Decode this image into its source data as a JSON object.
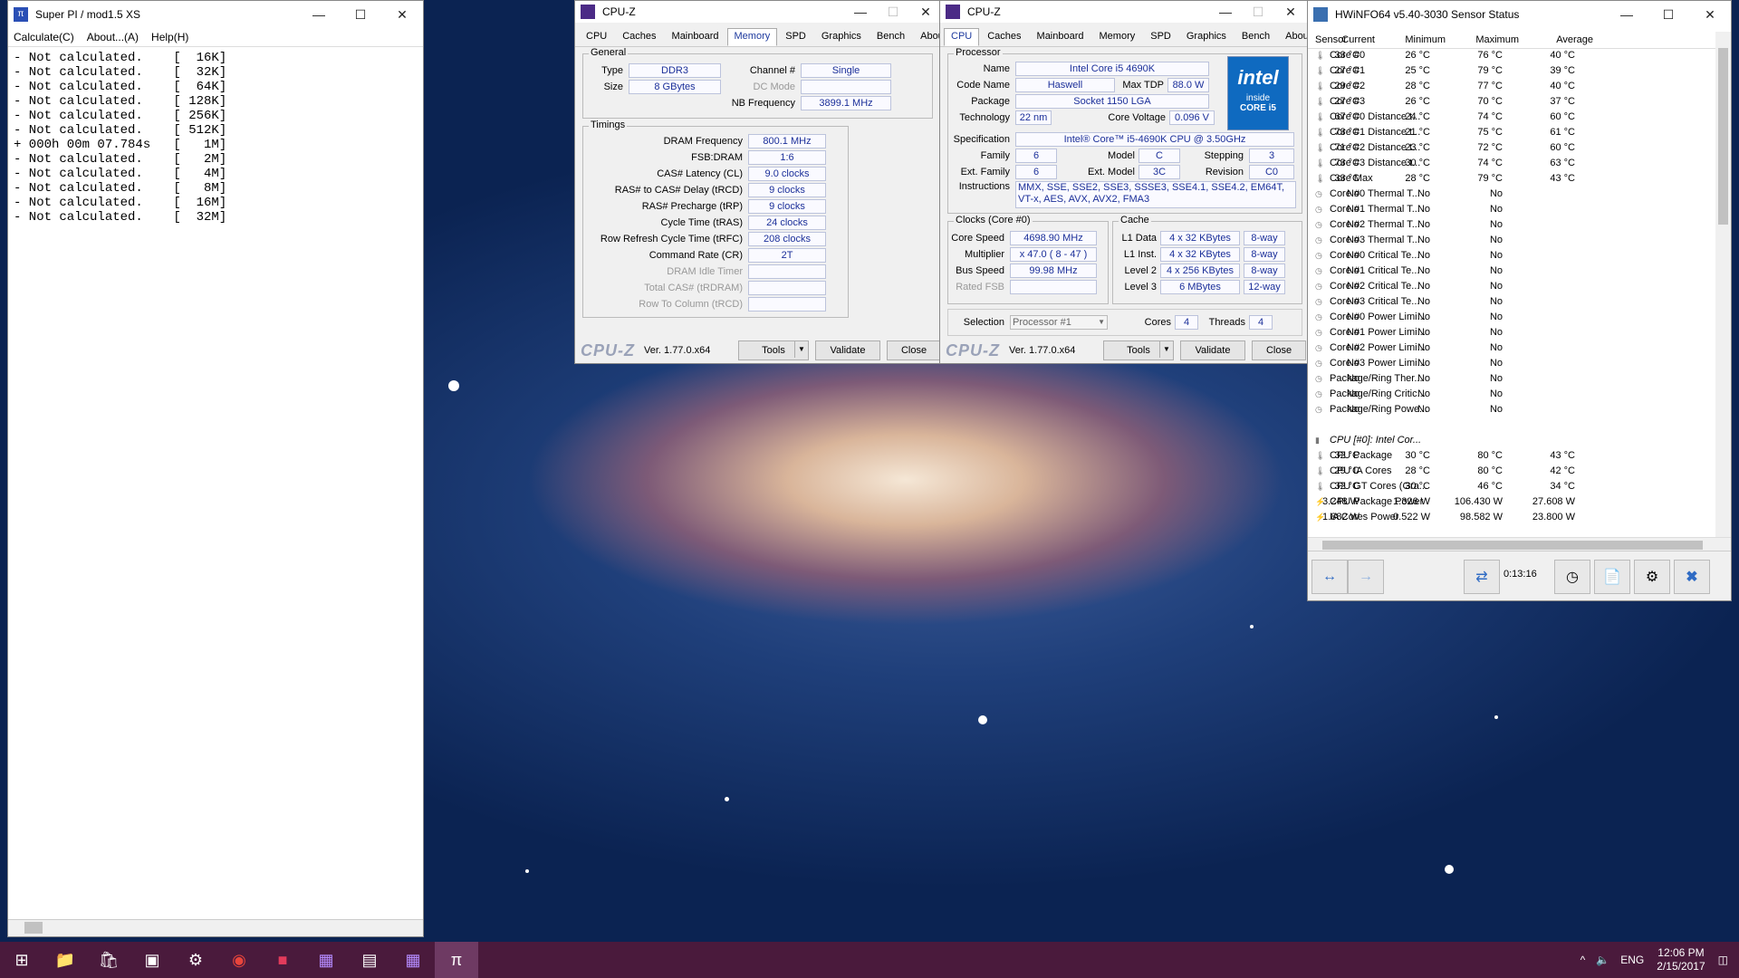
{
  "superpi": {
    "title": "Super PI / mod1.5 XS",
    "menu": [
      "Calculate(C)",
      "About...(A)",
      "Help(H)"
    ],
    "lines": [
      "- Not calculated.    [  16K]",
      "- Not calculated.    [  32K]",
      "- Not calculated.    [  64K]",
      "- Not calculated.    [ 128K]",
      "- Not calculated.    [ 256K]",
      "- Not calculated.    [ 512K]",
      "+ 000h 00m 07.784s   [   1M]",
      "- Not calculated.    [   2M]",
      "- Not calculated.    [   4M]",
      "- Not calculated.    [   8M]",
      "- Not calculated.    [  16M]",
      "- Not calculated.    [  32M]"
    ]
  },
  "cpuz_common": {
    "title": "CPU-Z",
    "tabs": [
      "CPU",
      "Caches",
      "Mainboard",
      "Memory",
      "SPD",
      "Graphics",
      "Bench",
      "About"
    ],
    "logo": "CPU-Z",
    "version": "Ver. 1.77.0.x64",
    "tools": "Tools",
    "validate": "Validate",
    "close": "Close"
  },
  "memory": {
    "general_title": "General",
    "type_label": "Type",
    "type": "DDR3",
    "size_label": "Size",
    "size": "8 GBytes",
    "channel_label": "Channel #",
    "channel": "Single",
    "dcmode_label": "DC Mode",
    "nbfreq_label": "NB Frequency",
    "nbfreq": "3899.1 MHz",
    "timings_title": "Timings",
    "timings": [
      {
        "label": "DRAM Frequency",
        "value": "800.1 MHz"
      },
      {
        "label": "FSB:DRAM",
        "value": "1:6"
      },
      {
        "label": "CAS# Latency (CL)",
        "value": "9.0 clocks"
      },
      {
        "label": "RAS# to CAS# Delay (tRCD)",
        "value": "9 clocks"
      },
      {
        "label": "RAS# Precharge (tRP)",
        "value": "9 clocks"
      },
      {
        "label": "Cycle Time (tRAS)",
        "value": "24 clocks"
      },
      {
        "label": "Row Refresh Cycle Time (tRFC)",
        "value": "208 clocks"
      },
      {
        "label": "Command Rate (CR)",
        "value": "2T"
      },
      {
        "label": "DRAM Idle Timer",
        "value": ""
      },
      {
        "label": "Total CAS# (tRDRAM)",
        "value": ""
      },
      {
        "label": "Row To Column (tRCD)",
        "value": ""
      }
    ]
  },
  "cpu": {
    "processor_title": "Processor",
    "name_label": "Name",
    "name": "Intel Core i5 4690K",
    "codename_label": "Code Name",
    "codename": "Haswell",
    "tdp_label": "Max TDP",
    "tdp": "88.0 W",
    "package_label": "Package",
    "package": "Socket 1150 LGA",
    "tech_label": "Technology",
    "tech": "22 nm",
    "voltage_label": "Core Voltage",
    "voltage": "0.096 V",
    "spec_label": "Specification",
    "spec": "Intel® Core™ i5-4690K CPU @ 3.50GHz",
    "family_label": "Family",
    "family": "6",
    "model_label": "Model",
    "model": "C",
    "stepping_label": "Stepping",
    "stepping": "3",
    "extfamily_label": "Ext. Family",
    "extfamily": "6",
    "extmodel_label": "Ext. Model",
    "extmodel": "3C",
    "revision_label": "Revision",
    "revision": "C0",
    "instr_label": "Instructions",
    "instr": "MMX, SSE, SSE2, SSE3, SSSE3, SSE4.1, SSE4.2, EM64T, VT-x, AES, AVX, AVX2, FMA3",
    "intel_logo": "intel",
    "intel_inside": "inside",
    "intel_core": "CORE i5",
    "clocks_title": "Clocks (Core #0)",
    "corespeed_label": "Core Speed",
    "corespeed": "4698.90 MHz",
    "multiplier_label": "Multiplier",
    "multiplier": "x 47.0 ( 8 - 47 )",
    "busspeed_label": "Bus Speed",
    "busspeed": "99.98 MHz",
    "ratedfsb_label": "Rated FSB",
    "cache_title": "Cache",
    "cache": [
      {
        "label": "L1 Data",
        "size": "4 x 32 KBytes",
        "way": "8-way"
      },
      {
        "label": "L1 Inst.",
        "size": "4 x 32 KBytes",
        "way": "8-way"
      },
      {
        "label": "Level 2",
        "size": "4 x 256 KBytes",
        "way": "8-way"
      },
      {
        "label": "Level 3",
        "size": "6 MBytes",
        "way": "12-way"
      }
    ],
    "selection_label": "Selection",
    "selection": "Processor #1",
    "cores_label": "Cores",
    "cores": "4",
    "threads_label": "Threads",
    "threads": "4"
  },
  "hwinfo": {
    "title": "HWiNFO64 v5.40-3030 Sensor Status",
    "headers": [
      "Sensor",
      "Current",
      "Minimum",
      "Maximum",
      "Average"
    ],
    "rows": [
      {
        "name": "Core #0",
        "icon": "thermometer-icon",
        "cur": "33 °C",
        "min": "26 °C",
        "max": "76 °C",
        "avg": "40 °C"
      },
      {
        "name": "Core #1",
        "icon": "thermometer-icon",
        "cur": "27 °C",
        "min": "25 °C",
        "max": "79 °C",
        "avg": "39 °C"
      },
      {
        "name": "Core #2",
        "icon": "thermometer-icon",
        "cur": "29 °C",
        "min": "28 °C",
        "max": "77 °C",
        "avg": "40 °C"
      },
      {
        "name": "Core #3",
        "icon": "thermometer-icon",
        "cur": "27 °C",
        "min": "26 °C",
        "max": "70 °C",
        "avg": "37 °C"
      },
      {
        "name": "Core #0 Distance t...",
        "icon": "thermometer-icon",
        "cur": "67 °C",
        "min": "24 °C",
        "max": "74 °C",
        "avg": "60 °C"
      },
      {
        "name": "Core #1 Distance t...",
        "icon": "thermometer-icon",
        "cur": "73 °C",
        "min": "21 °C",
        "max": "75 °C",
        "avg": "61 °C"
      },
      {
        "name": "Core #2 Distance t...",
        "icon": "thermometer-icon",
        "cur": "71 °C",
        "min": "23 °C",
        "max": "72 °C",
        "avg": "60 °C"
      },
      {
        "name": "Core #3 Distance t...",
        "icon": "thermometer-icon",
        "cur": "73 °C",
        "min": "30 °C",
        "max": "74 °C",
        "avg": "63 °C"
      },
      {
        "name": "Core Max",
        "icon": "thermometer-icon",
        "cur": "33 °C",
        "min": "28 °C",
        "max": "79 °C",
        "avg": "43 °C"
      },
      {
        "name": "Core #0 Thermal T...",
        "icon": "clock-icon",
        "cur": "No",
        "min": "No",
        "max": "No",
        "avg": ""
      },
      {
        "name": "Core #1 Thermal T...",
        "icon": "clock-icon",
        "cur": "No",
        "min": "No",
        "max": "No",
        "avg": ""
      },
      {
        "name": "Core #2 Thermal T...",
        "icon": "clock-icon",
        "cur": "No",
        "min": "No",
        "max": "No",
        "avg": ""
      },
      {
        "name": "Core #3 Thermal T...",
        "icon": "clock-icon",
        "cur": "No",
        "min": "No",
        "max": "No",
        "avg": ""
      },
      {
        "name": "Core #0 Critical Te...",
        "icon": "clock-icon",
        "cur": "No",
        "min": "No",
        "max": "No",
        "avg": ""
      },
      {
        "name": "Core #1 Critical Te...",
        "icon": "clock-icon",
        "cur": "No",
        "min": "No",
        "max": "No",
        "avg": ""
      },
      {
        "name": "Core #2 Critical Te...",
        "icon": "clock-icon",
        "cur": "No",
        "min": "No",
        "max": "No",
        "avg": ""
      },
      {
        "name": "Core #3 Critical Te...",
        "icon": "clock-icon",
        "cur": "No",
        "min": "No",
        "max": "No",
        "avg": ""
      },
      {
        "name": "Core #0 Power Limi...",
        "icon": "clock-icon",
        "cur": "No",
        "min": "No",
        "max": "No",
        "avg": ""
      },
      {
        "name": "Core #1 Power Limi...",
        "icon": "clock-icon",
        "cur": "No",
        "min": "No",
        "max": "No",
        "avg": ""
      },
      {
        "name": "Core #2 Power Limi...",
        "icon": "clock-icon",
        "cur": "No",
        "min": "No",
        "max": "No",
        "avg": ""
      },
      {
        "name": "Core #3 Power Limi...",
        "icon": "clock-icon",
        "cur": "No",
        "min": "No",
        "max": "No",
        "avg": ""
      },
      {
        "name": "Package/Ring Ther...",
        "icon": "clock-icon",
        "cur": "No",
        "min": "No",
        "max": "No",
        "avg": ""
      },
      {
        "name": "Package/Ring Critic...",
        "icon": "clock-icon",
        "cur": "No",
        "min": "No",
        "max": "No",
        "avg": ""
      },
      {
        "name": "Package/Ring Powe...",
        "icon": "clock-icon",
        "cur": "No",
        "min": "No",
        "max": "No",
        "avg": ""
      },
      {
        "name": "",
        "icon": "",
        "cur": "",
        "min": "",
        "max": "",
        "avg": ""
      },
      {
        "name": "CPU [#0]: Intel Cor...",
        "icon": "chip-icon",
        "cur": "",
        "min": "",
        "max": "",
        "avg": "",
        "group": true
      },
      {
        "name": "CPU Package",
        "icon": "thermometer-icon",
        "cur": "32 °C",
        "min": "30 °C",
        "max": "80 °C",
        "avg": "43 °C"
      },
      {
        "name": "CPU IA Cores",
        "icon": "thermometer-icon",
        "cur": "29 °C",
        "min": "28 °C",
        "max": "80 °C",
        "avg": "42 °C"
      },
      {
        "name": "CPU GT Cores (Gra...",
        "icon": "thermometer-icon",
        "cur": "32 °C",
        "min": "30 °C",
        "max": "46 °C",
        "avg": "34 °C"
      },
      {
        "name": "CPU Package Power",
        "icon": "bolt-icon",
        "cur": "3.248 W",
        "min": "1.326 W",
        "max": "106.430 W",
        "avg": "27.608 W"
      },
      {
        "name": "IA Cores Power",
        "icon": "bolt-icon",
        "cur": "1.882 W",
        "min": "0.522 W",
        "max": "98.582 W",
        "avg": "23.800 W"
      }
    ],
    "elapsed": "0:13:16"
  },
  "taskbar": {
    "lang": "ENG",
    "time": "12:06 PM",
    "date": "2/15/2017"
  }
}
